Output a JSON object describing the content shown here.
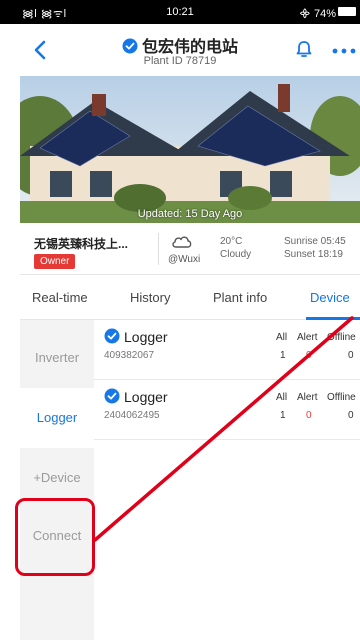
{
  "status_bar": {
    "signal": "᯼l ᯼ᯤl",
    "time": "10:21",
    "battery_text": "᯽ 74%"
  },
  "header": {
    "title": "包宏伟的电站",
    "plant_id": "Plant ID 78719",
    "icons": [
      "back-icon",
      "verified-badge-icon",
      "bell-icon",
      "more-icon"
    ]
  },
  "hero": {
    "updated": "Updated: 15 Day Ago"
  },
  "info": {
    "company": "无锡英臻科技上...",
    "role_badge": "Owner",
    "location": "@Wuxi",
    "temperature": "20°C",
    "sky": "Cloudy",
    "sunrise": "Sunrise 05:45",
    "sunset": "Sunset 18:19"
  },
  "tabs": [
    {
      "label": "Real-time"
    },
    {
      "label": "History"
    },
    {
      "label": "Plant info"
    },
    {
      "label": "Device",
      "active": true
    }
  ],
  "side_nav": [
    {
      "label": "Inverter"
    },
    {
      "label": "Logger",
      "active": true
    },
    {
      "label": "+Device"
    },
    {
      "label": "Connect"
    }
  ],
  "stat_headers": {
    "all": "All",
    "alert": "Alert",
    "offline": "Offline"
  },
  "loggers": [
    {
      "name": "Logger",
      "serial": "409382067",
      "all": "1",
      "alert": "0",
      "offline": "0"
    },
    {
      "name": "Logger",
      "serial": "2404062495",
      "all": "1",
      "alert": "0",
      "offline": "0"
    }
  ],
  "colors": {
    "accent": "#1677e6",
    "owner_badge": "#e53935",
    "annotation": "#e0001a"
  }
}
